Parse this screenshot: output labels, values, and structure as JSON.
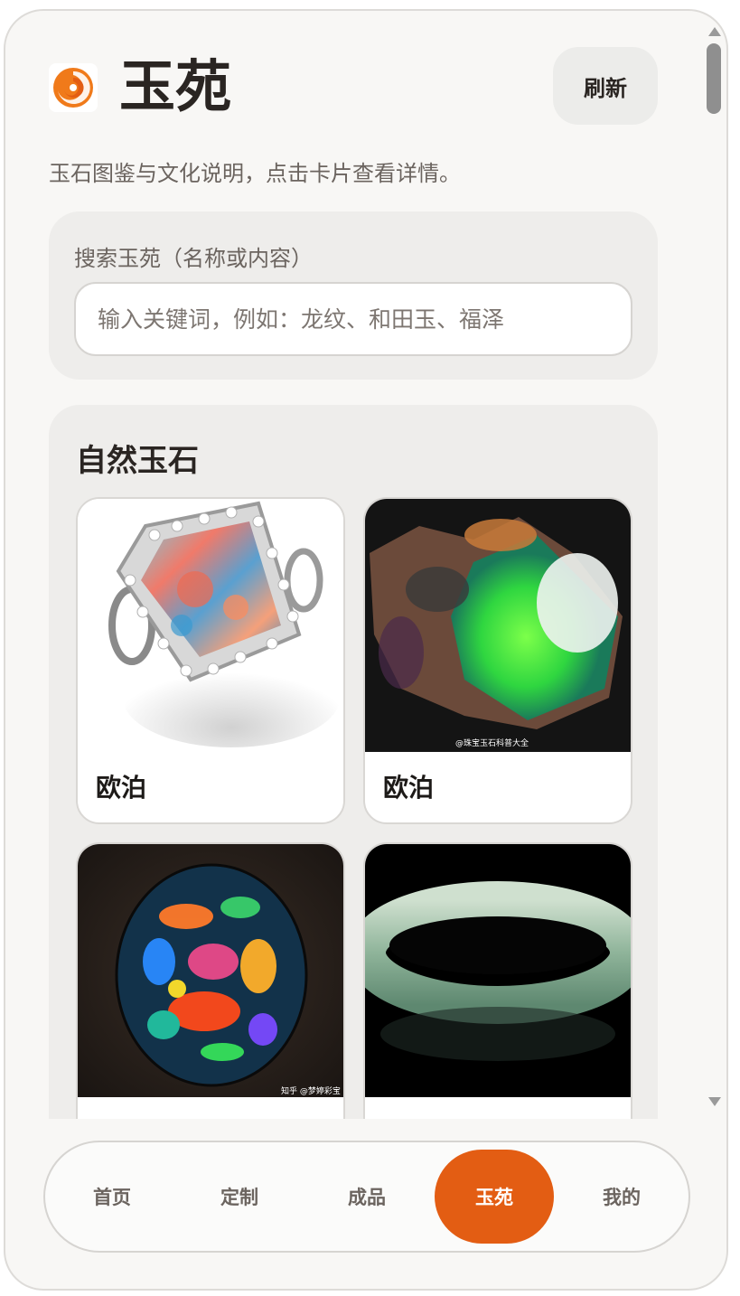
{
  "app": {
    "title": "玉苑",
    "refresh_label": "刷新",
    "subtitle": "玉石图鉴与文化说明，点击卡片查看详情。"
  },
  "search": {
    "label": "搜索玉苑（名称或内容）",
    "placeholder": "输入关键词，例如：龙纹、和田玉、福泽",
    "value": ""
  },
  "section": {
    "title": "自然玉石",
    "cards": [
      {
        "name": "欧泊",
        "image": "opal-ring-image"
      },
      {
        "name": "欧泊",
        "image": "raw-opal-image",
        "watermark": "@珠宝玉石科普大全"
      },
      {
        "name": "",
        "image": "black-opal-image",
        "watermark": "知乎 @梦婷彩宝"
      },
      {
        "name": "",
        "image": "jade-bangle-image"
      }
    ]
  },
  "nav": {
    "items": [
      {
        "label": "首页",
        "active": false
      },
      {
        "label": "定制",
        "active": false
      },
      {
        "label": "成品",
        "active": false
      },
      {
        "label": "玉苑",
        "active": true
      },
      {
        "label": "我的",
        "active": false
      }
    ]
  },
  "colors": {
    "accent": "#e35d13",
    "background": "#f8f7f5",
    "panel": "#eeedeb",
    "text": "#2a2522"
  }
}
